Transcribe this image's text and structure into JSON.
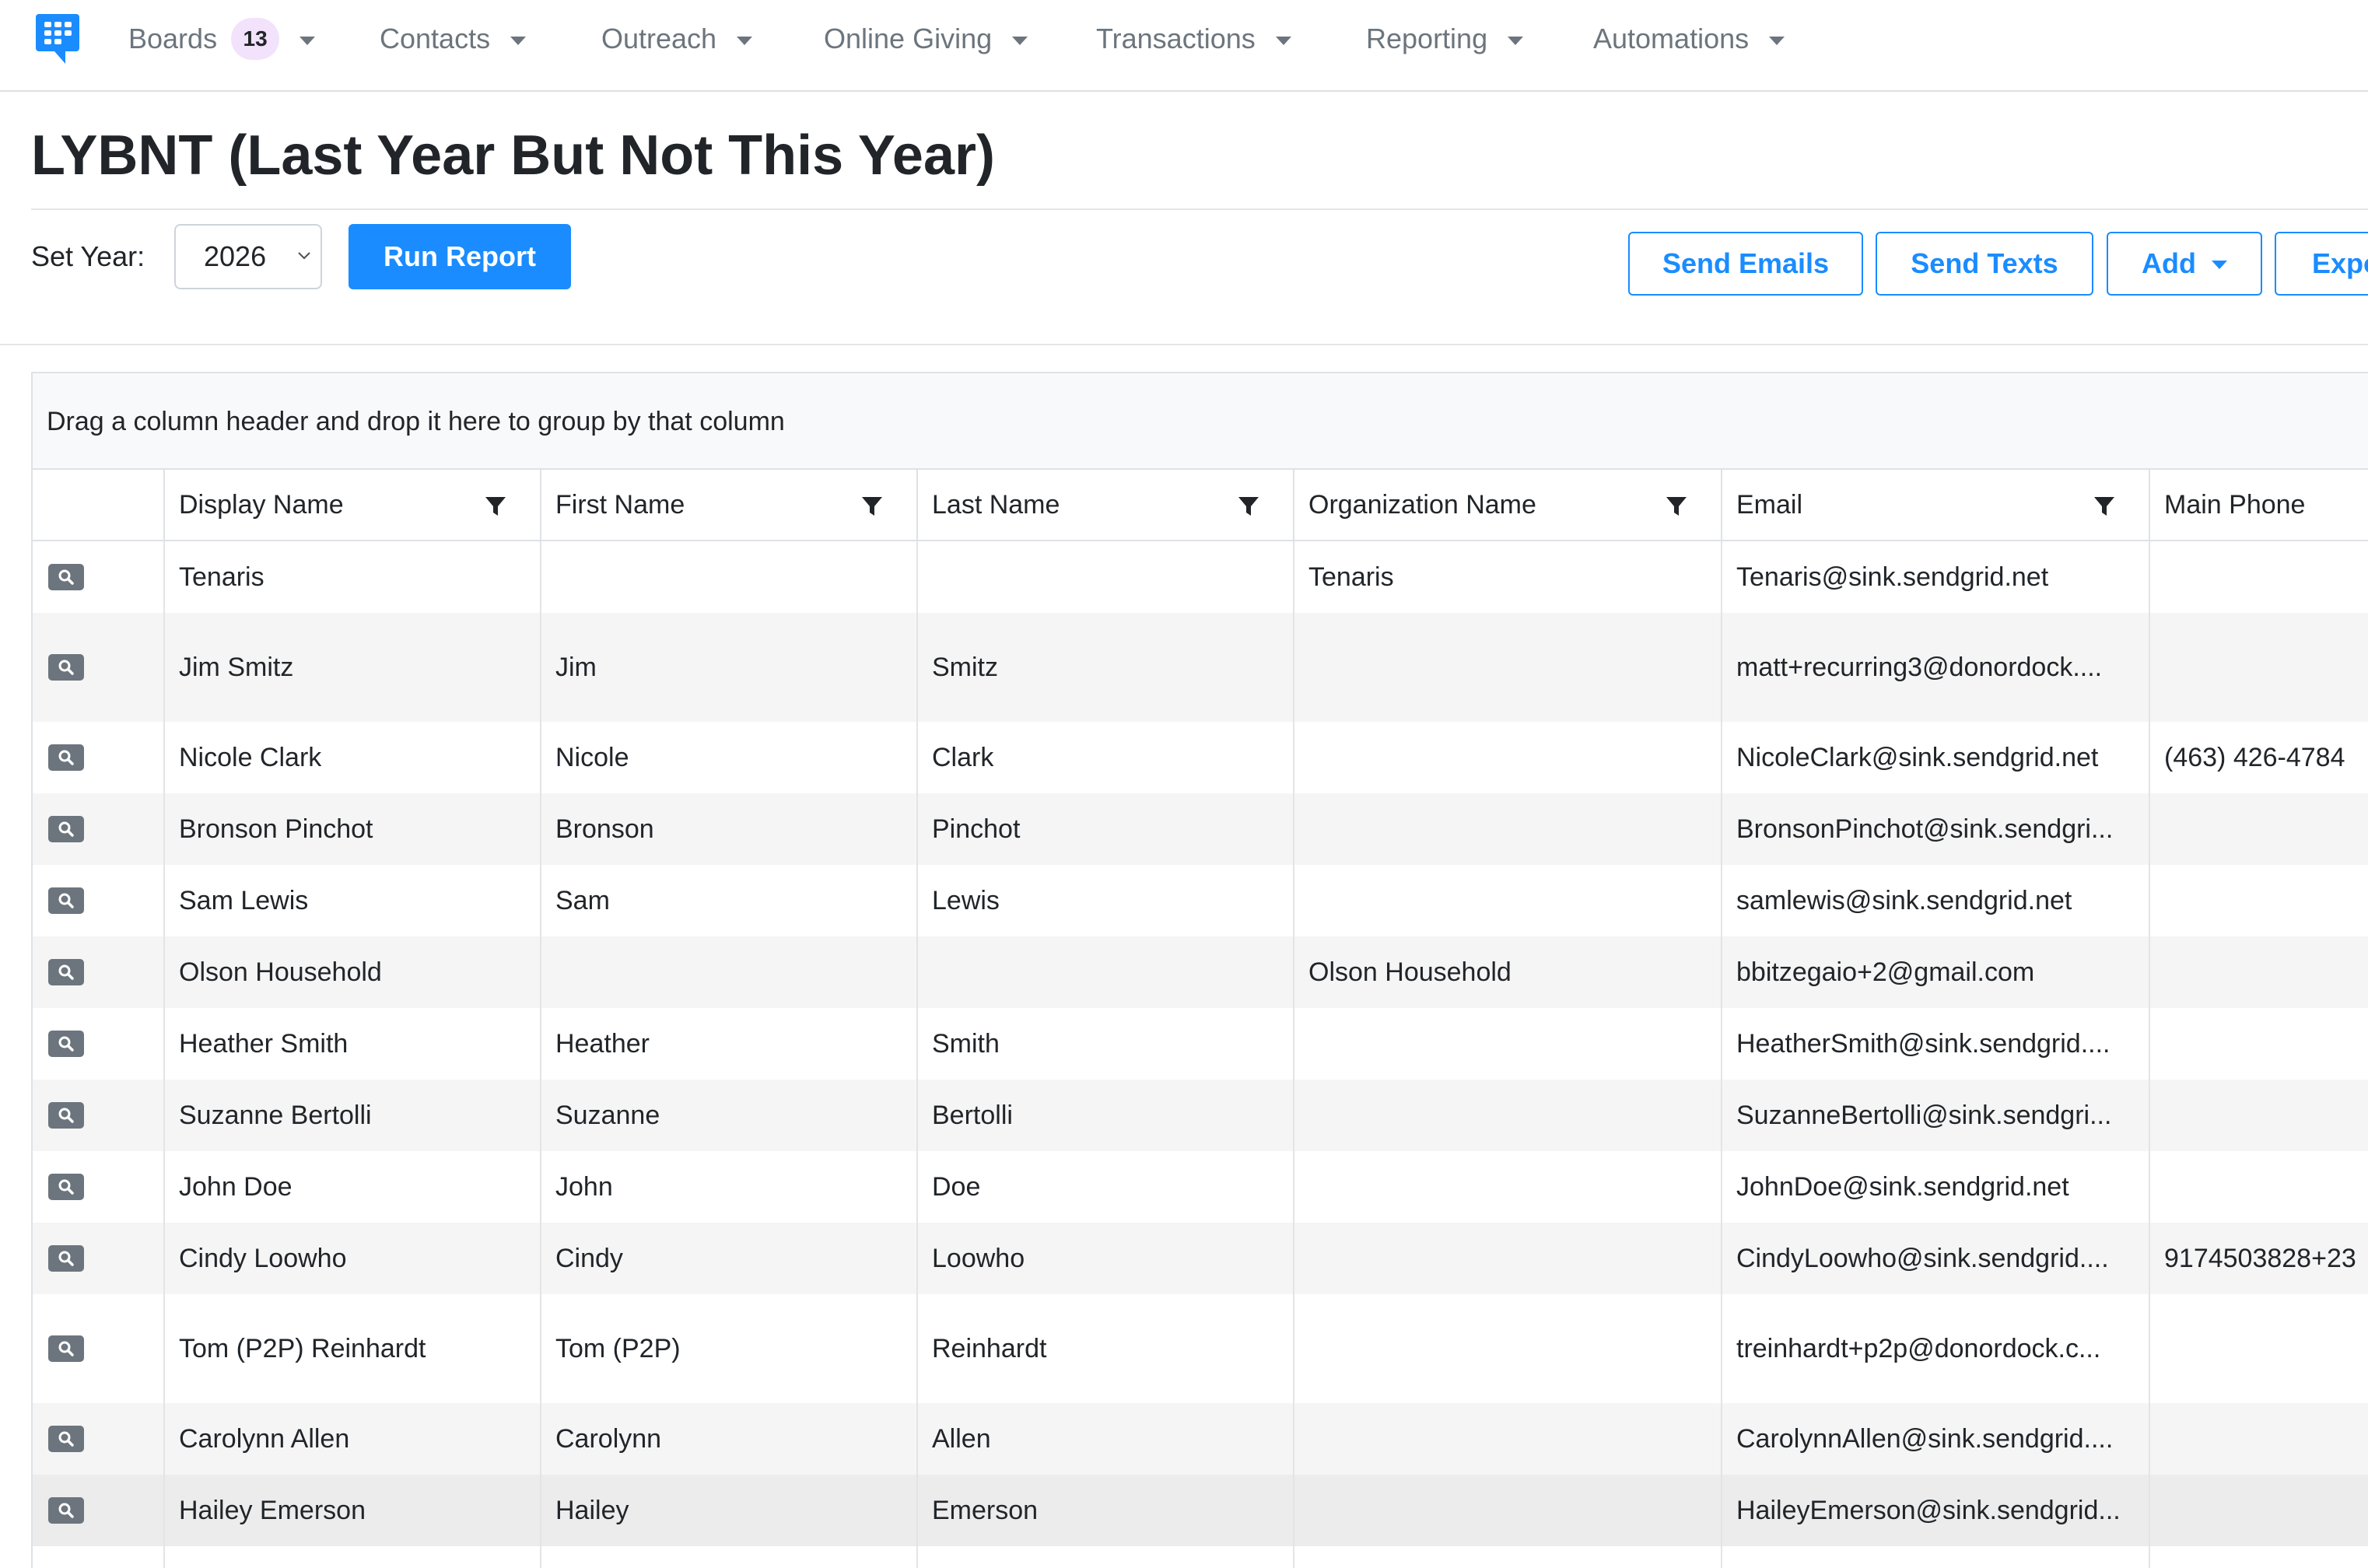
{
  "nav": {
    "items": [
      {
        "label": "Boards",
        "badge": "13"
      },
      {
        "label": "Contacts"
      },
      {
        "label": "Outreach"
      },
      {
        "label": "Online Giving"
      },
      {
        "label": "Transactions"
      },
      {
        "label": "Reporting"
      },
      {
        "label": "Automations"
      }
    ]
  },
  "page": {
    "title": "LYBNT (Last Year But Not This Year)"
  },
  "controls": {
    "set_year_label": "Set Year:",
    "year_value": "2026",
    "run_report_label": "Run Report",
    "send_emails_label": "Send Emails",
    "send_texts_label": "Send Texts",
    "add_label": "Add",
    "export_label": "Expo"
  },
  "grid": {
    "group_panel_text": "Drag a column header and drop it here to group by that column",
    "columns": [
      {
        "label": ""
      },
      {
        "label": "Display Name"
      },
      {
        "label": "First Name"
      },
      {
        "label": "Last Name"
      },
      {
        "label": "Organization Name"
      },
      {
        "label": "Email"
      },
      {
        "label": "Main Phone"
      }
    ],
    "rows": [
      {
        "cells": [
          "Tenaris",
          "",
          "",
          "Tenaris",
          "Tenaris@sink.sendgrid.net",
          ""
        ]
      },
      {
        "cells": [
          "Jim Smitz",
          "Jim",
          "Smitz",
          "",
          "matt+recurring3@donordock....",
          ""
        ]
      },
      {
        "cells": [
          "Nicole Clark",
          "Nicole",
          "Clark",
          "",
          "NicoleClark@sink.sendgrid.net",
          "(463) 426-4784"
        ]
      },
      {
        "cells": [
          "Bronson Pinchot",
          "Bronson",
          "Pinchot",
          "",
          "BronsonPinchot@sink.sendgri...",
          ""
        ]
      },
      {
        "cells": [
          "Sam Lewis",
          "Sam",
          "Lewis",
          "",
          "samlewis@sink.sendgrid.net",
          ""
        ]
      },
      {
        "cells": [
          "Olson Household",
          "",
          "",
          "Olson Household",
          "bbitzegaio+2@gmail.com",
          ""
        ]
      },
      {
        "cells": [
          "Heather Smith",
          "Heather",
          "Smith",
          "",
          "HeatherSmith@sink.sendgrid....",
          ""
        ]
      },
      {
        "cells": [
          "Suzanne Bertolli",
          "Suzanne",
          "Bertolli",
          "",
          "SuzanneBertolli@sink.sendgri...",
          ""
        ]
      },
      {
        "cells": [
          "John Doe",
          "John",
          "Doe",
          "",
          "JohnDoe@sink.sendgrid.net",
          ""
        ]
      },
      {
        "cells": [
          "Cindy Loowho",
          "Cindy",
          "Loowho",
          "",
          "CindyLoowho@sink.sendgrid....",
          "9174503828+23"
        ]
      },
      {
        "cells": [
          "Tom (P2P) Reinhardt",
          "Tom (P2P)",
          "Reinhardt",
          "",
          "treinhardt+p2p@donordock.c...",
          ""
        ]
      },
      {
        "cells": [
          "Carolynn Allen",
          "Carolynn",
          "Allen",
          "",
          "CarolynnAllen@sink.sendgrid....",
          ""
        ]
      },
      {
        "cells": [
          "Hailey Emerson",
          "Hailey",
          "Emerson",
          "",
          "HaileyEmerson@sink.sendgrid...",
          ""
        ]
      },
      {
        "cells": [
          "",
          "",
          "",
          "",
          "",
          ""
        ]
      }
    ]
  },
  "colors": {
    "primary": "#1a8cff",
    "nav_text": "#6c757d",
    "badge_bg": "#f3e2fb",
    "row_alt": "#f5f5f5",
    "border": "#dee2e6"
  }
}
